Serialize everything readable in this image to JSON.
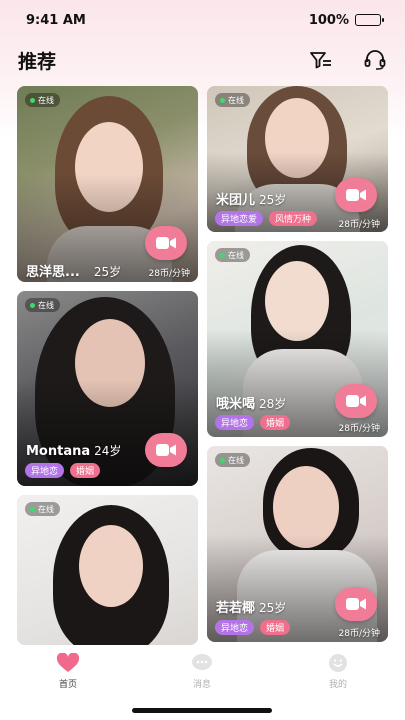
{
  "status_bar": {
    "time": "9:41 AM",
    "battery": "100%"
  },
  "header": {
    "title": "推荐",
    "filter_icon": "filter-icon",
    "service_icon": "headset-icon"
  },
  "cards": [
    {
      "online": "在线",
      "name": "思洋思...",
      "age": "25岁",
      "price": "28币/分钟",
      "tags": []
    },
    {
      "online": "在线",
      "name": "米团儿",
      "age": "25岁",
      "price": "28币/分钟",
      "tags": [
        "异地恋爱",
        "风情万种"
      ]
    },
    {
      "online": "在线",
      "name": "Montana",
      "age": "24岁",
      "price": "",
      "tags": [
        "异地恋",
        "婚姻"
      ]
    },
    {
      "online": "在线",
      "name": "哦米喝",
      "age": "28岁",
      "price": "28币/分钟",
      "tags": [
        "异地恋",
        "婚姻"
      ]
    },
    {
      "online": "在线",
      "name": "",
      "age": "",
      "price": "",
      "tags": []
    },
    {
      "online": "在线",
      "name": "若若椰",
      "age": "25岁",
      "price": "28币/分钟",
      "tags": [
        "异地恋",
        "婚姻"
      ]
    }
  ],
  "tabbar": {
    "items": [
      {
        "label": "首页",
        "icon": "heart-icon",
        "active": true
      },
      {
        "label": "消息",
        "icon": "chat-icon",
        "active": false
      },
      {
        "label": "我的",
        "icon": "smile-icon",
        "active": false
      }
    ]
  },
  "colors": {
    "accent": "#f17c97",
    "tag_pink": "#ef6f8c",
    "tag_purple": "#b374e8"
  }
}
